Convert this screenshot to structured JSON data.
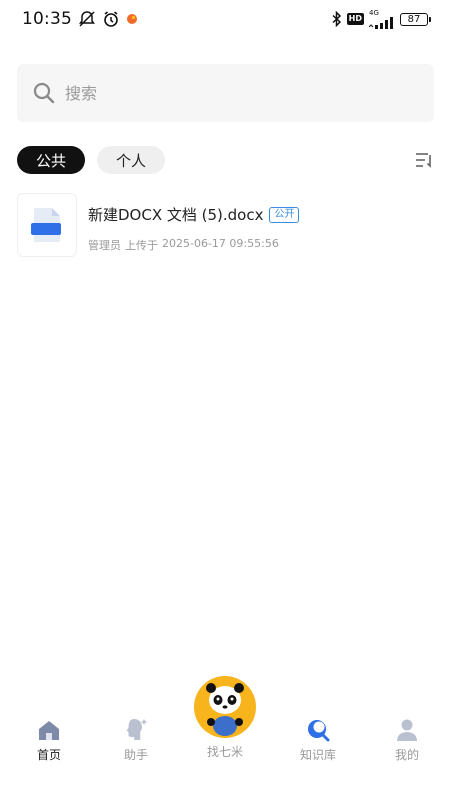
{
  "status_bar": {
    "time": "10:35",
    "battery": "87",
    "hd_badge": "HD",
    "network": "4G",
    "notification_dot_color": "#f06a2a"
  },
  "search": {
    "placeholder": "搜索"
  },
  "tabs": [
    {
      "label": "公共",
      "active": true
    },
    {
      "label": "个人",
      "active": false
    }
  ],
  "files": [
    {
      "name": "新建DOCX 文档 (5).docx",
      "badge": "公开",
      "uploader": "管理员",
      "action": "上传于",
      "timestamp": "2025-06-17 09:55:56",
      "thumb_label": "DOC"
    }
  ],
  "bottom_nav": {
    "items": [
      {
        "label": "首页",
        "icon": "home-icon",
        "active": true
      },
      {
        "label": "助手",
        "icon": "assistant-icon",
        "active": false
      },
      {
        "label": "找七米",
        "icon": "panda-mascot-icon",
        "active": false
      },
      {
        "label": "知识库",
        "icon": "knowledge-base-icon",
        "active": false
      },
      {
        "label": "我的",
        "icon": "profile-icon",
        "active": false
      }
    ]
  },
  "colors": {
    "accent_blue": "#2f6fe8",
    "center_button": "#f8b41c",
    "badge_blue": "#3a8de0"
  }
}
